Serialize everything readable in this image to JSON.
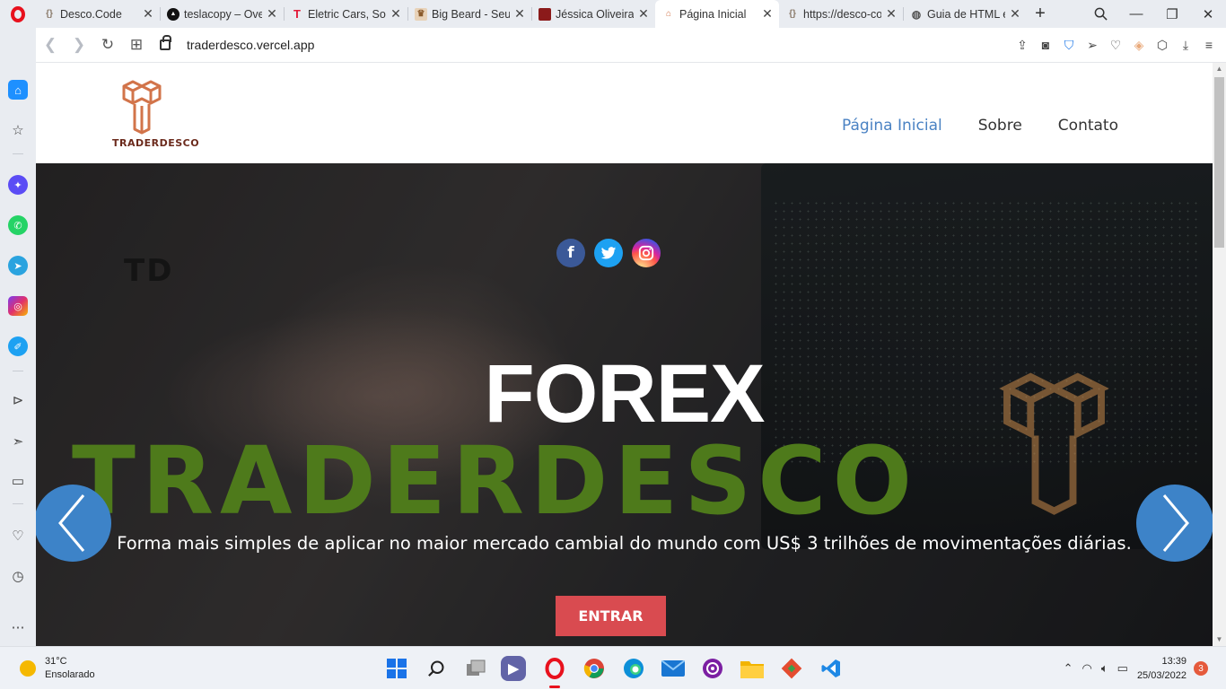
{
  "browser": {
    "tabs": [
      {
        "title": "Desco.Code",
        "favicon": "code-brackets",
        "fav_color": "#8a7a6a",
        "active": false
      },
      {
        "title": "teslacopy – Ove",
        "favicon": "vercel-triangle",
        "fav_color": "#111111",
        "active": false
      },
      {
        "title": "Eletric Cars, Sola",
        "favicon": "tesla-logo",
        "fav_color": "#e31937",
        "active": false
      },
      {
        "title": "Big Beard - Seu",
        "favicon": "barber-logo",
        "fav_color": "#b07a4a",
        "active": false
      },
      {
        "title": "Jéssica Oliveira",
        "favicon": "portrait",
        "fav_color": "#8b1a1a",
        "active": false
      },
      {
        "title": "Página Inicial",
        "favicon": "traderdesco-logo",
        "fav_color": "#d2744a",
        "active": true
      },
      {
        "title": "https://desco-co",
        "favicon": "code-brackets",
        "fav_color": "#8a7a6a",
        "active": false
      },
      {
        "title": "Guia de HTML e",
        "favicon": "globe",
        "fav_color": "#555555",
        "active": false
      }
    ],
    "url": "traderdesco.vercel.app"
  },
  "site": {
    "logo_text": "TRADERDESCO",
    "nav": [
      {
        "label": "Página Inicial",
        "current": true
      },
      {
        "label": "Sobre",
        "current": false
      },
      {
        "label": "Contato",
        "current": false
      }
    ],
    "hero": {
      "watermark": "TD",
      "title": "FOREX",
      "brand": "TRADERDESCO",
      "subtitle": "Forma mais simples de aplicar no maior mercado cambial do mundo com US$ 3 trilhões de movimentações diárias.",
      "cta": "ENTRAR",
      "brand_color": "#4e7a1b",
      "cta_color": "#d94b50"
    },
    "social": [
      "facebook",
      "twitter",
      "instagram"
    ]
  },
  "taskbar": {
    "weather_temp": "31°C",
    "weather_desc": "Ensolarado",
    "time": "13:39",
    "date": "25/03/2022",
    "notifications": "3"
  }
}
